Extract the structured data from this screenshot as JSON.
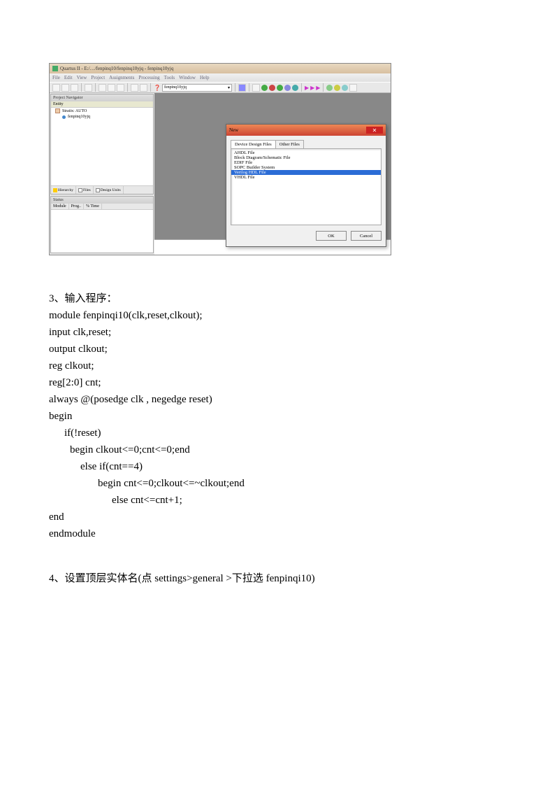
{
  "app": {
    "title": "Quartus II - E:/…/fenpinq10/fenpinq10yjq - fenpinq10yjq",
    "menus": [
      "File",
      "Edit",
      "View",
      "Project",
      "Assignments",
      "Processing",
      "Tools",
      "Window",
      "Help"
    ],
    "combo": "fenpinq10yjq"
  },
  "nav": {
    "title": "Project Navigator",
    "head": "Entity",
    "row1": "Stratix: AUTO",
    "row2": "fenpinq10yjq",
    "tabs": [
      "Hierarchy",
      "Files",
      "Design Units"
    ]
  },
  "status": {
    "title": "Status",
    "cols": [
      "Module",
      "Prog..",
      "% Time "
    ]
  },
  "dialog": {
    "title": "New",
    "tabs": [
      "Device Design Files",
      "Other Files"
    ],
    "items": [
      "AHDL File",
      "Block Diagram/Schematic File",
      "EDIF File",
      "SOPC Builder System",
      "Verilog HDL File",
      "VHDL File"
    ],
    "selectedIndex": 4,
    "ok": "OK",
    "cancel": "Cancel"
  },
  "section3": {
    "heading": "3、输入程序：",
    "lines": [
      "module fenpinqi10(clk,reset,clkout);",
      "input    clk,reset;",
      "output clkout;",
      "reg clkout;",
      "reg[2:0] cnt;",
      "always @(posedge clk , negedge reset)",
      "begin"
    ],
    "l_if": "if(!reset)",
    "l_begin1": "begin    clkout<=0;cnt<=0;end",
    "l_elseif": "else if(cnt==4)",
    "l_begin2": "begin cnt<=0;clkout<=~clkout;end",
    "l_else": "else cnt<=cnt+1;",
    "l_end": "end",
    "l_endmod": "endmodule"
  },
  "section4": "4、设置顶层实体名(点 settings>general >下拉选 fenpinqi10)"
}
